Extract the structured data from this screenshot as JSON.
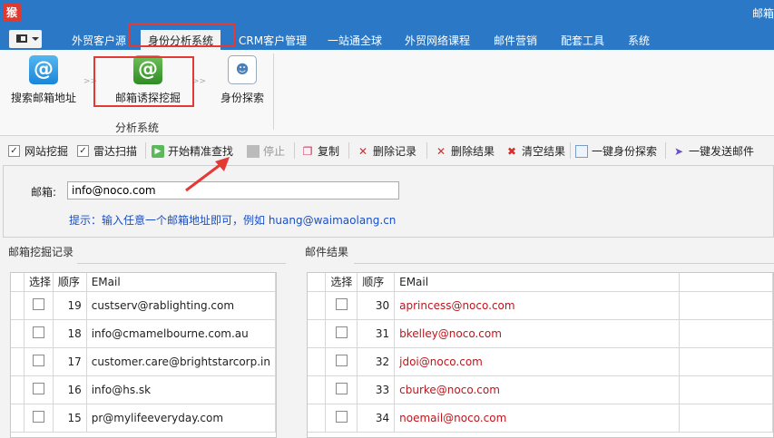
{
  "app": {
    "logo_text": "猴",
    "window_title": "邮箱"
  },
  "ribbon_tabs": [
    "外贸客户源",
    "身份分析系统",
    "CRM客户管理",
    "一站通全球",
    "外贸网络课程",
    "邮件营销",
    "配套工具",
    "系统"
  ],
  "ribbon": {
    "buttons": [
      {
        "label": "搜索邮箱地址",
        "icon": "at-sign-icon"
      },
      {
        "label": "邮箱诱探挖掘",
        "icon": "at-sign-icon"
      },
      {
        "label": "身份探索",
        "icon": "id-card-icon"
      }
    ],
    "group_label": "分析系统"
  },
  "toolbar": {
    "website_check": "网站挖掘",
    "radar_check": "雷达扫描",
    "start": "开始精准查找",
    "stop": "停止",
    "copy": "复制",
    "delete_records": "删除记录",
    "delete_results": "删除结果",
    "clear_results": "清空结果",
    "identity_search": "一键身份探索",
    "send_mail": "一键发送邮件"
  },
  "email_panel": {
    "label": "邮箱:",
    "value": "info@noco.com",
    "hint": "提示：输入任意一个邮箱地址即可，例如 huang@waimaolang.cn"
  },
  "left_grid": {
    "title": "邮箱挖掘记录",
    "headers": [
      "选择",
      "顺序",
      "EMail"
    ],
    "rows": [
      {
        "order": "19",
        "email": "custserv@rablighting.com"
      },
      {
        "order": "18",
        "email": "info@cmamelbourne.com.au"
      },
      {
        "order": "17",
        "email": "customer.care@brightstarcorp.in"
      },
      {
        "order": "16",
        "email": "info@hs.sk"
      },
      {
        "order": "15",
        "email": "pr@mylifeeveryday.com"
      }
    ]
  },
  "right_grid": {
    "title": "邮件结果",
    "headers": [
      "选择",
      "顺序",
      "EMail"
    ],
    "rows": [
      {
        "order": "30",
        "email": "aprincess@noco.com"
      },
      {
        "order": "31",
        "email": "bkelley@noco.com"
      },
      {
        "order": "32",
        "email": "jdoi@noco.com"
      },
      {
        "order": "33",
        "email": "cburke@noco.com"
      },
      {
        "order": "34",
        "email": "noemail@noco.com"
      }
    ]
  },
  "colors": {
    "accent": "#2b78c6",
    "highlight": "#e53935",
    "result_email": "#c0141c",
    "hint": "#1a4fc4"
  }
}
